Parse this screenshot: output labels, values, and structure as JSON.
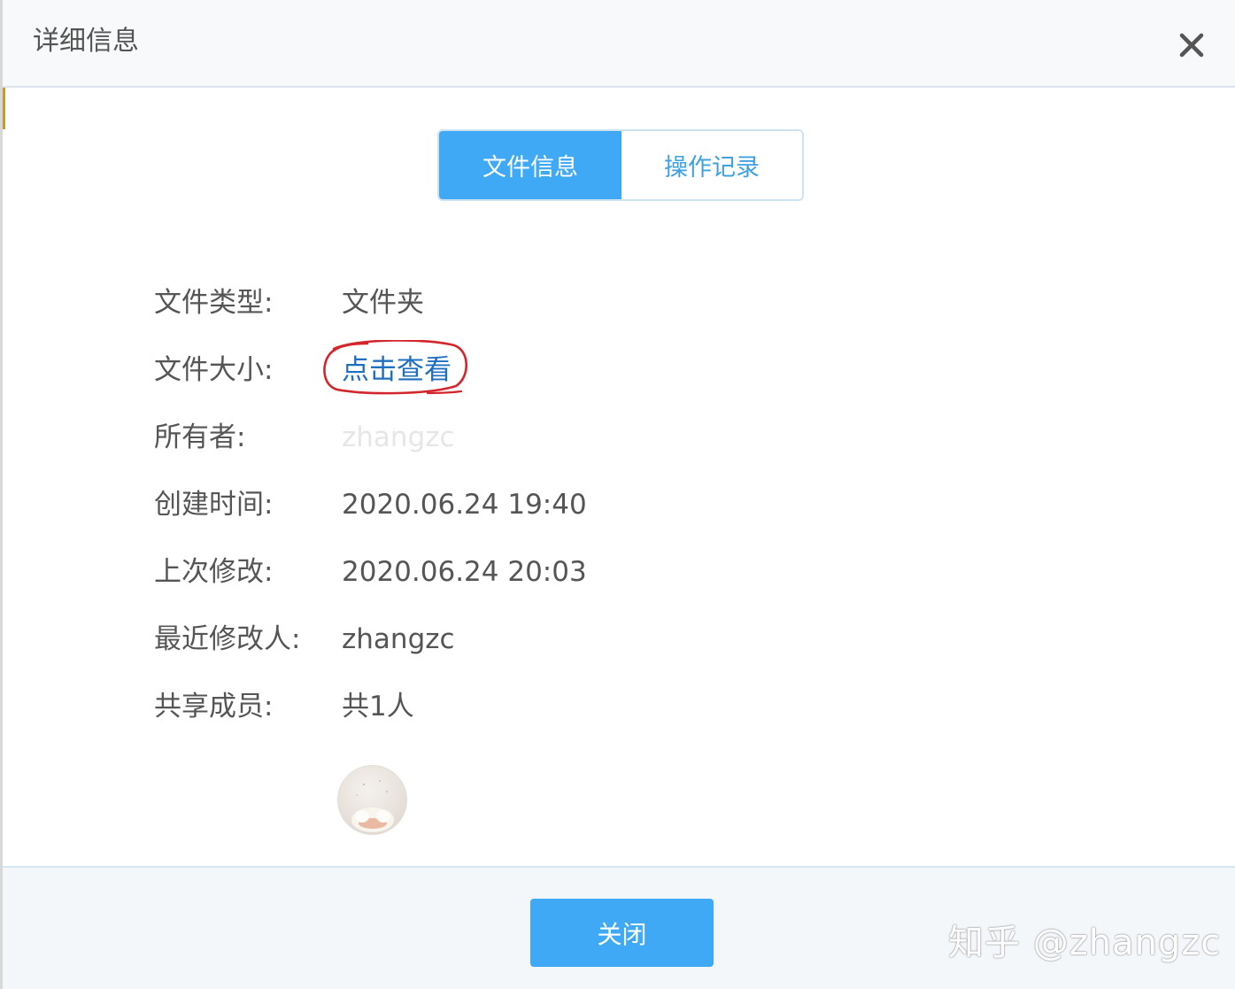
{
  "dialog": {
    "title": "详细信息"
  },
  "tabs": [
    {
      "label": "文件信息",
      "active": true
    },
    {
      "label": "操作记录",
      "active": false
    }
  ],
  "details": {
    "file_type": {
      "label": "文件类型:",
      "value": "文件夹"
    },
    "file_size": {
      "label": "文件大小:",
      "value": "点击查看"
    },
    "owner": {
      "label": "所有者:",
      "value": "zhangzc"
    },
    "created": {
      "label": "创建时间:",
      "value": "2020.06.24 19:40"
    },
    "modified": {
      "label": "上次修改:",
      "value": "2020.06.24 20:03"
    },
    "last_modifier": {
      "label": "最近修改人:",
      "value": "zhangzc"
    },
    "shared_members": {
      "label": "共享成员:",
      "value": "共1人"
    }
  },
  "footer": {
    "close_label": "关闭",
    "watermark": "知乎 @zhangzc"
  },
  "colors": {
    "accent": "#3fa9f5",
    "link": "#1f6fc0",
    "annotation": "#d4242c"
  },
  "icons": {
    "close": "close-icon"
  }
}
